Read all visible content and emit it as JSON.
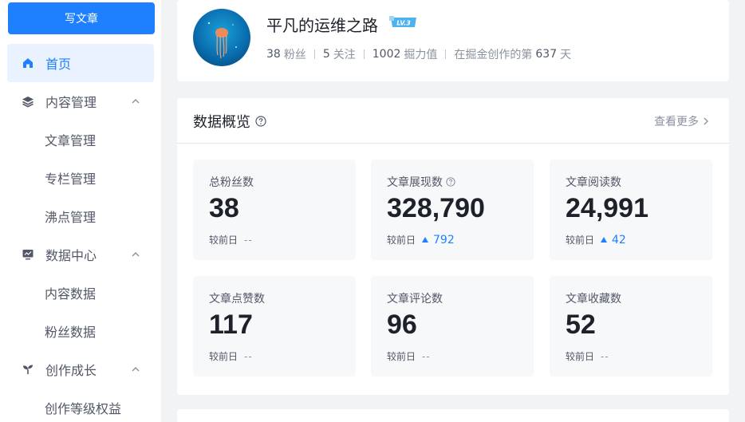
{
  "sidebar": {
    "write_button": "写文章",
    "items": [
      {
        "label": "首页",
        "icon": "home-icon",
        "active": true
      },
      {
        "label": "内容管理",
        "icon": "layers-icon",
        "expanded": true
      },
      {
        "label": "文章管理",
        "sub": true
      },
      {
        "label": "专栏管理",
        "sub": true
      },
      {
        "label": "沸点管理",
        "sub": true
      },
      {
        "label": "数据中心",
        "icon": "monitor-chart-icon",
        "expanded": true
      },
      {
        "label": "内容数据",
        "sub": true
      },
      {
        "label": "粉丝数据",
        "sub": true
      },
      {
        "label": "创作成长",
        "icon": "sprout-icon",
        "expanded": true
      },
      {
        "label": "创作等级权益",
        "sub": true
      }
    ]
  },
  "profile": {
    "name": "平凡的运维之路",
    "level_badge": "LV.3",
    "followers_num": "38",
    "followers_label": "粉丝",
    "following_num": "5",
    "following_label": "关注",
    "score_num": "1002",
    "score_label": "掘力值",
    "days_prefix": "在掘金创作的第",
    "days_num": "637",
    "days_suffix": "天"
  },
  "overview": {
    "title": "数据概览",
    "more": "查看更多",
    "compare_label": "较前日",
    "metrics": [
      {
        "label": "总粉丝数",
        "value": "38",
        "delta": "--",
        "trend": "flat"
      },
      {
        "label": "文章展现数",
        "value": "328,790",
        "delta": "792",
        "trend": "up",
        "help": true
      },
      {
        "label": "文章阅读数",
        "value": "24,991",
        "delta": "42",
        "trend": "up"
      },
      {
        "label": "文章点赞数",
        "value": "117",
        "delta": "--",
        "trend": "flat"
      },
      {
        "label": "文章评论数",
        "value": "96",
        "delta": "--",
        "trend": "flat"
      },
      {
        "label": "文章收藏数",
        "value": "52",
        "delta": "--",
        "trend": "flat"
      }
    ]
  },
  "colors": {
    "brand": "#1e80ff",
    "active_bg": "#eaf2ff",
    "page_bg": "#f2f3f5",
    "metric_bg": "#f7f8fa"
  }
}
